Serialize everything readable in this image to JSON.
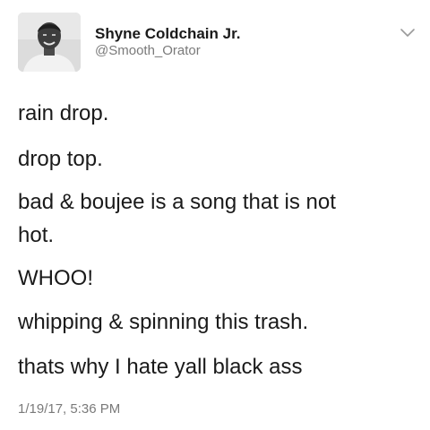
{
  "author": {
    "display_name": "Shyne Coldchain Jr.",
    "handle": "@Smooth_Orator"
  },
  "header_icons": {
    "avatar": "avatar-photo",
    "menu": "chevron-down-icon"
  },
  "tweet": {
    "lines": [
      "rain drop.",
      "drop top.",
      "bad & boujee is a song that is not",
      "hot.",
      "WHOO!",
      "whipping & spinning this trash.",
      "thats why I hate yall black ass"
    ],
    "timestamp": "1/19/17, 5:36 PM"
  },
  "colors": {
    "text": "#1a1a1a",
    "secondary_text": "#7a7a7a",
    "background": "#ffffff"
  }
}
